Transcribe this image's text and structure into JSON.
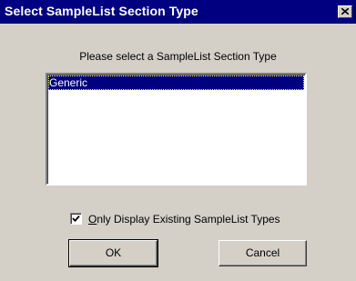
{
  "window": {
    "title": "Select SampleList Section Type",
    "close_icon": "close-icon"
  },
  "prompt": "Please select a SampleList Section Type",
  "section_types": {
    "items": [
      "Generic"
    ],
    "selected": "Generic"
  },
  "existing_only": {
    "checked": true,
    "label_mnemonic": "O",
    "label_rest": "nly Display Existing SampleList Types"
  },
  "buttons": {
    "ok": "OK",
    "cancel": "Cancel"
  },
  "colors": {
    "titlebar": "#000080",
    "face": "#d4d0c8",
    "selection": "#000080"
  }
}
